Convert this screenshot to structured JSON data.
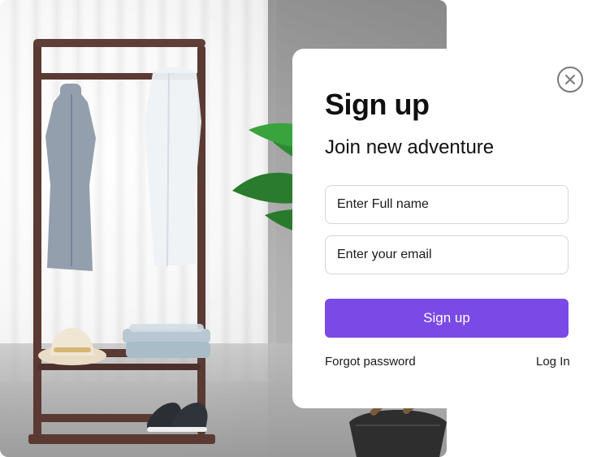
{
  "signup": {
    "title": "Sign up",
    "subtitle": "Join new adventure",
    "full_name_placeholder": "Enter Full name",
    "email_placeholder": "Enter your email",
    "submit_label": "Sign up",
    "forgot_password_label": "Forgot password",
    "login_label": "Log In",
    "accent_color": "#7a49e6"
  },
  "icons": {
    "close": "close-icon"
  }
}
